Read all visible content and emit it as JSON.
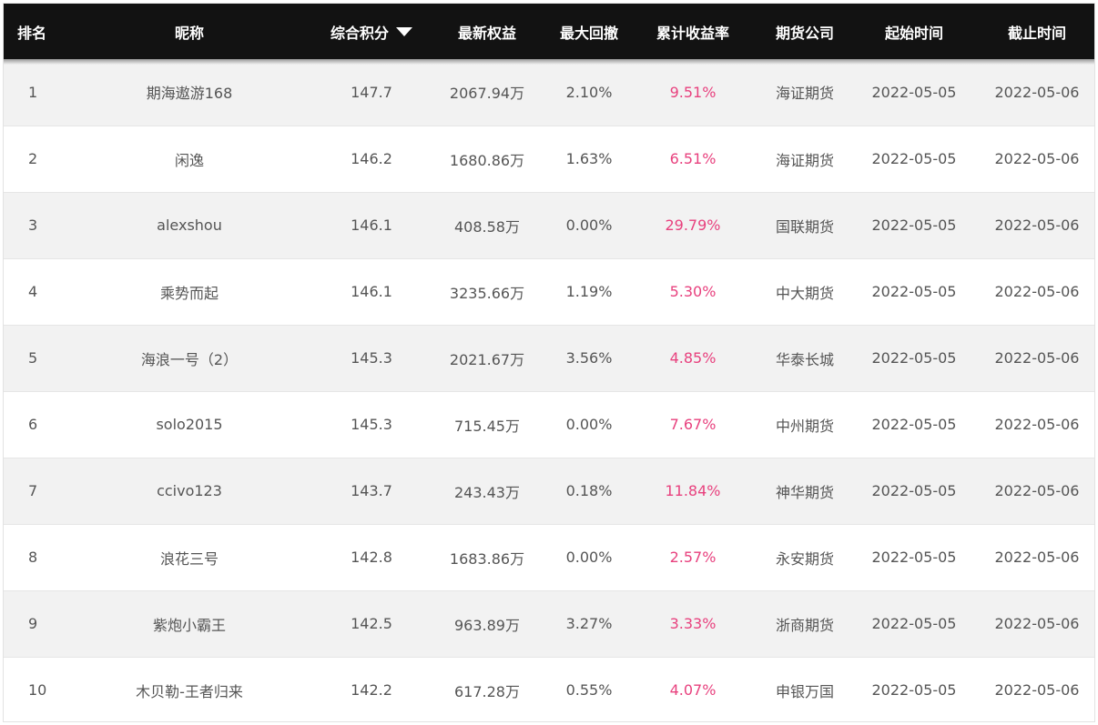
{
  "headers": {
    "rank": "排名",
    "nickname": "昵称",
    "score": "综合积分",
    "equity": "最新权益",
    "drawdown": "最大回撤",
    "return": "累计收益率",
    "company": "期货公司",
    "start": "起始时间",
    "end": "截止时间"
  },
  "sort_icon": "triangle-down-icon",
  "colors": {
    "header_bg": "#121212",
    "return_text": "#e8417e"
  },
  "rows": [
    {
      "rank": "1",
      "nickname": "期海遨游168",
      "score": "147.7",
      "equity": "2067.94万",
      "drawdown": "2.10%",
      "return": "9.51%",
      "company": "海证期货",
      "start": "2022-05-05",
      "end": "2022-05-06"
    },
    {
      "rank": "2",
      "nickname": "闲逸",
      "score": "146.2",
      "equity": "1680.86万",
      "drawdown": "1.63%",
      "return": "6.51%",
      "company": "海证期货",
      "start": "2022-05-05",
      "end": "2022-05-06"
    },
    {
      "rank": "3",
      "nickname": "alexshou",
      "score": "146.1",
      "equity": "408.58万",
      "drawdown": "0.00%",
      "return": "29.79%",
      "company": "国联期货",
      "start": "2022-05-05",
      "end": "2022-05-06"
    },
    {
      "rank": "4",
      "nickname": "乘势而起",
      "score": "146.1",
      "equity": "3235.66万",
      "drawdown": "1.19%",
      "return": "5.30%",
      "company": "中大期货",
      "start": "2022-05-05",
      "end": "2022-05-06"
    },
    {
      "rank": "5",
      "nickname": "海浪一号（2）",
      "score": "145.3",
      "equity": "2021.67万",
      "drawdown": "3.56%",
      "return": "4.85%",
      "company": "华泰长城",
      "start": "2022-05-05",
      "end": "2022-05-06"
    },
    {
      "rank": "6",
      "nickname": "solo2015",
      "score": "145.3",
      "equity": "715.45万",
      "drawdown": "0.00%",
      "return": "7.67%",
      "company": "中州期货",
      "start": "2022-05-05",
      "end": "2022-05-06"
    },
    {
      "rank": "7",
      "nickname": "ccivo123",
      "score": "143.7",
      "equity": "243.43万",
      "drawdown": "0.18%",
      "return": "11.84%",
      "company": "神华期货",
      "start": "2022-05-05",
      "end": "2022-05-06"
    },
    {
      "rank": "8",
      "nickname": "浪花三号",
      "score": "142.8",
      "equity": "1683.86万",
      "drawdown": "0.00%",
      "return": "2.57%",
      "company": "永安期货",
      "start": "2022-05-05",
      "end": "2022-05-06"
    },
    {
      "rank": "9",
      "nickname": "紫炮小霸王",
      "score": "142.5",
      "equity": "963.89万",
      "drawdown": "3.27%",
      "return": "3.33%",
      "company": "浙商期货",
      "start": "2022-05-05",
      "end": "2022-05-06"
    },
    {
      "rank": "10",
      "nickname": "木贝勒-王者归来",
      "score": "142.2",
      "equity": "617.28万",
      "drawdown": "0.55%",
      "return": "4.07%",
      "company": "申银万国",
      "start": "2022-05-05",
      "end": "2022-05-06"
    }
  ]
}
